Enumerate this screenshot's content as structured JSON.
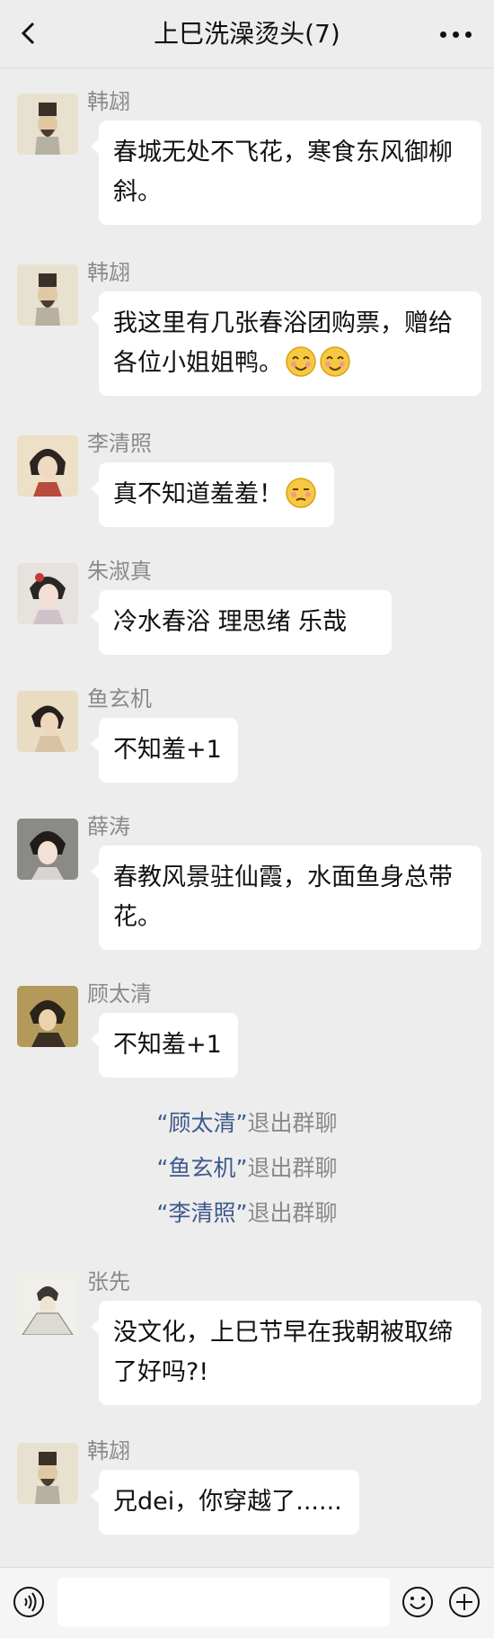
{
  "header": {
    "title": "上巳洗澡烫头(7)",
    "back_icon": "chevron-left-icon",
    "more_icon": "more-dots-icon"
  },
  "messages": [
    {
      "sender": "韩翃",
      "avatar": "han-hong-avatar",
      "text": "春城无处不飞花，寒食东风御柳斜。"
    },
    {
      "sender": "韩翃",
      "avatar": "han-hong-avatar",
      "text": "我这里有几张春浴团购票，赠给各位小姐姐鸭。",
      "emojis": [
        "blushing-smile-emoji",
        "blushing-smile-emoji"
      ]
    },
    {
      "sender": "李清照",
      "avatar": "li-qingzhao-avatar",
      "text": "真不知道羞羞！",
      "emojis": [
        "unamused-face-emoji"
      ]
    },
    {
      "sender": "朱淑真",
      "avatar": "zhu-shuzhen-avatar",
      "text": "冷水春浴 理思绪  乐哉"
    },
    {
      "sender": "鱼玄机",
      "avatar": "yu-xuanji-avatar",
      "text": "不知羞+1"
    },
    {
      "sender": "薛涛",
      "avatar": "xue-tao-avatar",
      "text": "春教风景驻仙霞，水面鱼身总带花。"
    },
    {
      "sender": "顾太清",
      "avatar": "gu-taiqing-avatar",
      "text": "不知羞+1"
    },
    {
      "sender": "张先",
      "avatar": "zhang-xian-avatar",
      "text": "没文化，上巳节早在我朝被取缔了好吗?!"
    },
    {
      "sender": "韩翃",
      "avatar": "han-hong-avatar",
      "text": "兄dei，你穿越了......"
    }
  ],
  "system_notices": [
    {
      "open_quote": "“",
      "name": "顾太清",
      "close_quote": "”",
      "text": "退出群聊"
    },
    {
      "open_quote": "“",
      "name": "鱼玄机",
      "close_quote": "”",
      "text": "退出群聊"
    },
    {
      "open_quote": "“",
      "name": "李清照",
      "close_quote": "”",
      "text": "退出群聊"
    }
  ],
  "input_bar": {
    "voice_icon": "voice-icon",
    "emoji_icon": "emoji-icon",
    "plus_icon": "plus-icon",
    "input_value": ""
  },
  "colors": {
    "background": "#ededed",
    "bubble": "#ffffff",
    "sender_text": "#8a8a8a",
    "system_name": "#3d5a8c"
  }
}
